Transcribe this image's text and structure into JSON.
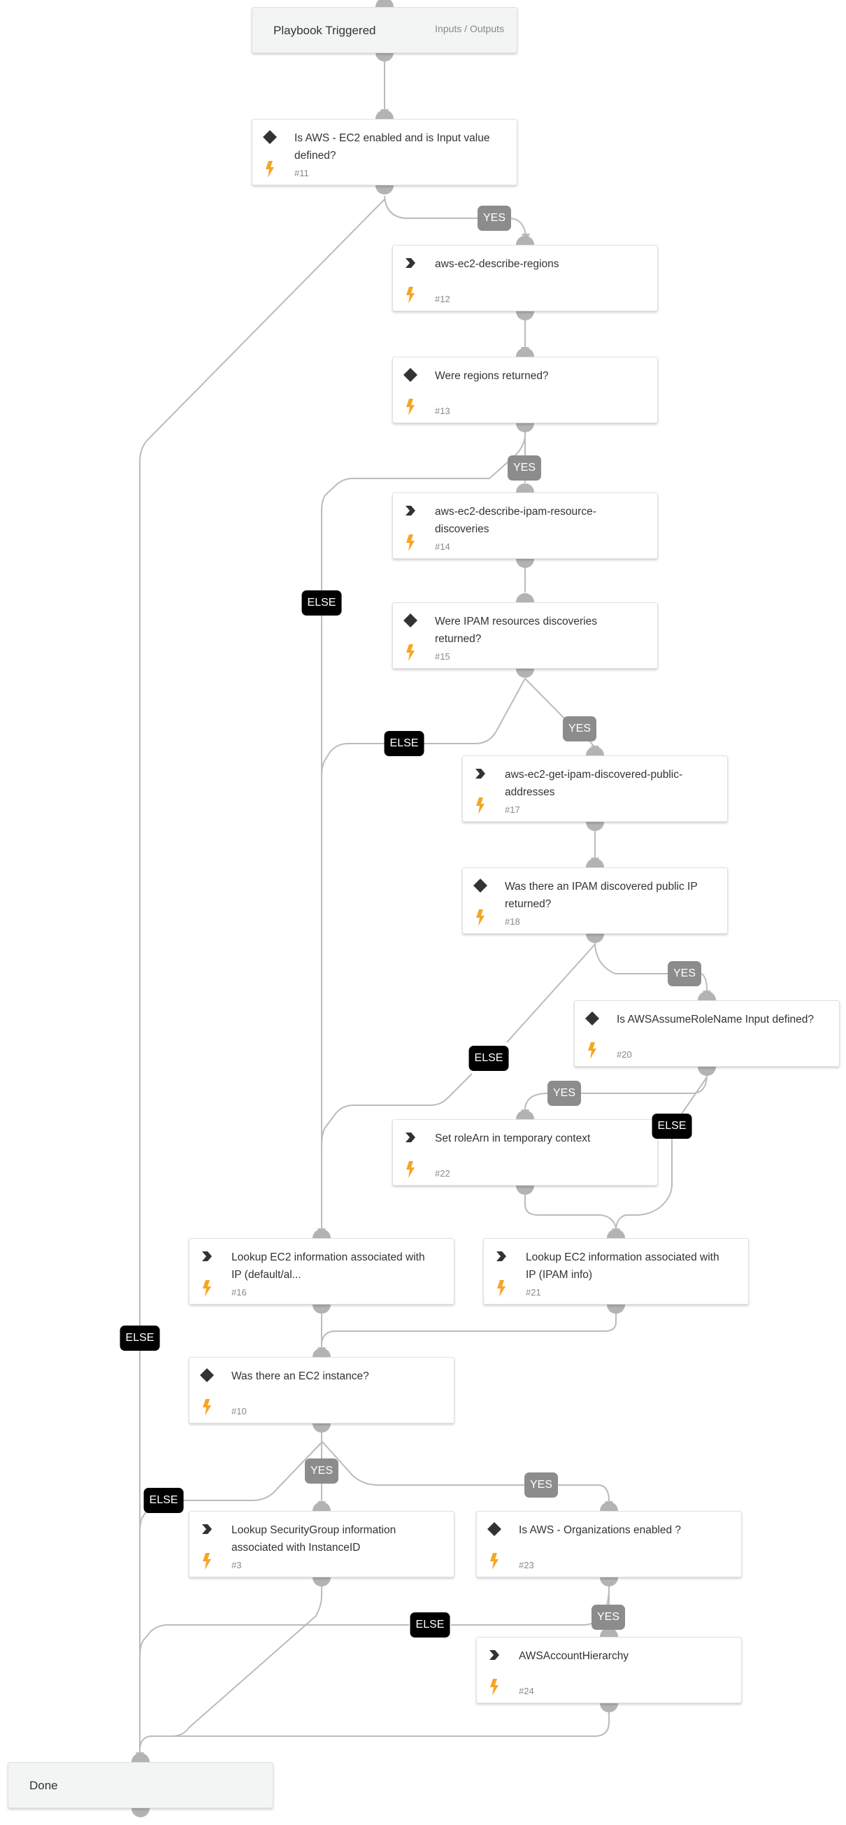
{
  "colors": {
    "edge": "#bbbbbb",
    "connector": "#b3b3b3",
    "yes_label": "#8c8c8c",
    "else_label": "#000000",
    "bolt": "#f5a623",
    "icon": "#333333"
  },
  "trigger": {
    "title": "Playbook Triggered",
    "io_link": "Inputs / Outputs"
  },
  "done": {
    "title": "Done"
  },
  "nodes": [
    {
      "key": "n11",
      "type": "condition",
      "title": "Is AWS - EC2 enabled and is Input value defined?",
      "id": "#11"
    },
    {
      "key": "n12",
      "type": "task",
      "title": "aws-ec2-describe-regions",
      "id": "#12"
    },
    {
      "key": "n13",
      "type": "condition",
      "title": "Were regions returned?",
      "id": "#13"
    },
    {
      "key": "n14",
      "type": "task",
      "title": "aws-ec2-describe-ipam-resource-discoveries",
      "id": "#14"
    },
    {
      "key": "n15",
      "type": "condition",
      "title": "Were IPAM resources discoveries returned?",
      "id": "#15"
    },
    {
      "key": "n17",
      "type": "task",
      "title": "aws-ec2-get-ipam-discovered-public-addresses",
      "id": "#17"
    },
    {
      "key": "n18",
      "type": "condition",
      "title": "Was there an IPAM discovered public IP returned?",
      "id": "#18"
    },
    {
      "key": "n20",
      "type": "condition",
      "title": "Is AWSAssumeRoleName Input defined?",
      "id": "#20"
    },
    {
      "key": "n22",
      "type": "task",
      "title": "Set roleArn in temporary context",
      "id": "#22"
    },
    {
      "key": "n16",
      "type": "task",
      "title": "Lookup EC2 information associated with IP (default/al...",
      "id": "#16"
    },
    {
      "key": "n21",
      "type": "task",
      "title": "Lookup EC2 information associated with IP (IPAM info)",
      "id": "#21"
    },
    {
      "key": "n10",
      "type": "condition",
      "title": "Was there an EC2 instance?",
      "id": "#10"
    },
    {
      "key": "n3",
      "type": "task",
      "title": "Lookup SecurityGroup information associated with InstanceID",
      "id": "#3"
    },
    {
      "key": "n23",
      "type": "condition",
      "title": "Is AWS - Organizations enabled ?",
      "id": "#23"
    },
    {
      "key": "n24",
      "type": "task",
      "title": "AWSAccountHierarchy",
      "id": "#24"
    }
  ],
  "edge_labels": {
    "yes": "YES",
    "else": "ELSE"
  },
  "edges": [
    {
      "from": "trigger",
      "to": "n11",
      "label": null
    },
    {
      "from": "n11",
      "to": "n12",
      "label": "YES"
    },
    {
      "from": "n11",
      "to": "done",
      "label": "ELSE"
    },
    {
      "from": "n12",
      "to": "n13",
      "label": null
    },
    {
      "from": "n13",
      "to": "n14",
      "label": "YES"
    },
    {
      "from": "n13",
      "to": "n16",
      "label": "ELSE"
    },
    {
      "from": "n14",
      "to": "n15",
      "label": null
    },
    {
      "from": "n15",
      "to": "n17",
      "label": "YES"
    },
    {
      "from": "n15",
      "to": "n16",
      "label": "ELSE"
    },
    {
      "from": "n17",
      "to": "n18",
      "label": null
    },
    {
      "from": "n18",
      "to": "n20",
      "label": "YES"
    },
    {
      "from": "n18",
      "to": "n16",
      "label": "ELSE"
    },
    {
      "from": "n20",
      "to": "n22",
      "label": "YES"
    },
    {
      "from": "n20",
      "to": "n21",
      "label": "ELSE"
    },
    {
      "from": "n22",
      "to": "n21",
      "label": null
    },
    {
      "from": "n16",
      "to": "n10",
      "label": null
    },
    {
      "from": "n21",
      "to": "n10",
      "label": null
    },
    {
      "from": "n10",
      "to": "n3",
      "label": "YES"
    },
    {
      "from": "n10",
      "to": "n23",
      "label": "YES"
    },
    {
      "from": "n10",
      "to": "done",
      "label": "ELSE"
    },
    {
      "from": "n3",
      "to": "done",
      "label": null
    },
    {
      "from": "n23",
      "to": "n24",
      "label": "YES"
    },
    {
      "from": "n23",
      "to": "done",
      "label": "ELSE"
    },
    {
      "from": "n24",
      "to": "done",
      "label": null
    }
  ]
}
